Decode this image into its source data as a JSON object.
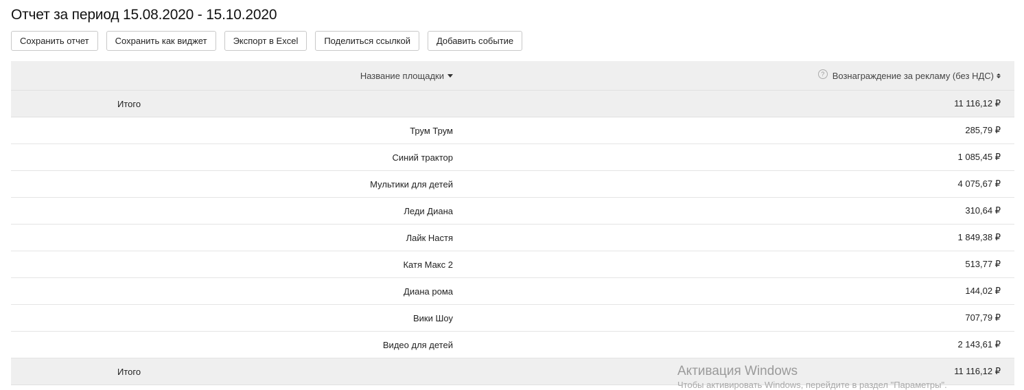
{
  "page": {
    "title": "Отчет за период 15.08.2020 - 15.10.2020"
  },
  "toolbar": {
    "buttons": [
      {
        "label": "Сохранить отчет"
      },
      {
        "label": "Сохранить как виджет"
      },
      {
        "label": "Экспорт в Excel"
      },
      {
        "label": "Поделиться ссылкой"
      },
      {
        "label": "Добавить событие"
      }
    ]
  },
  "table": {
    "columns": {
      "name": "Название площадки",
      "reward": "Вознаграждение за рекламу (без НДС)",
      "help_icon_glyph": "?"
    },
    "total_label": "Итого",
    "total_value": "11 116,12 ₽",
    "rows": [
      {
        "name": "Трум Трум",
        "value": "285,79 ₽"
      },
      {
        "name": "Синий трактор",
        "value": "1 085,45 ₽"
      },
      {
        "name": "Мультики для детей",
        "value": "4 075,67 ₽"
      },
      {
        "name": "Леди Диана",
        "value": "310,64 ₽"
      },
      {
        "name": "Лайк Настя",
        "value": "1 849,38 ₽"
      },
      {
        "name": "Катя Макс 2",
        "value": "513,77 ₽"
      },
      {
        "name": "Диана рома",
        "value": "144,02 ₽"
      },
      {
        "name": "Вики Шоу",
        "value": "707,79 ₽"
      },
      {
        "name": "Видео для детей",
        "value": "2 143,61 ₽"
      }
    ]
  },
  "overlay": {
    "watermark_title": "Активация Windows",
    "watermark_sub": "Чтобы активировать Windows, перейдите в раздел \"Параметры\"."
  }
}
